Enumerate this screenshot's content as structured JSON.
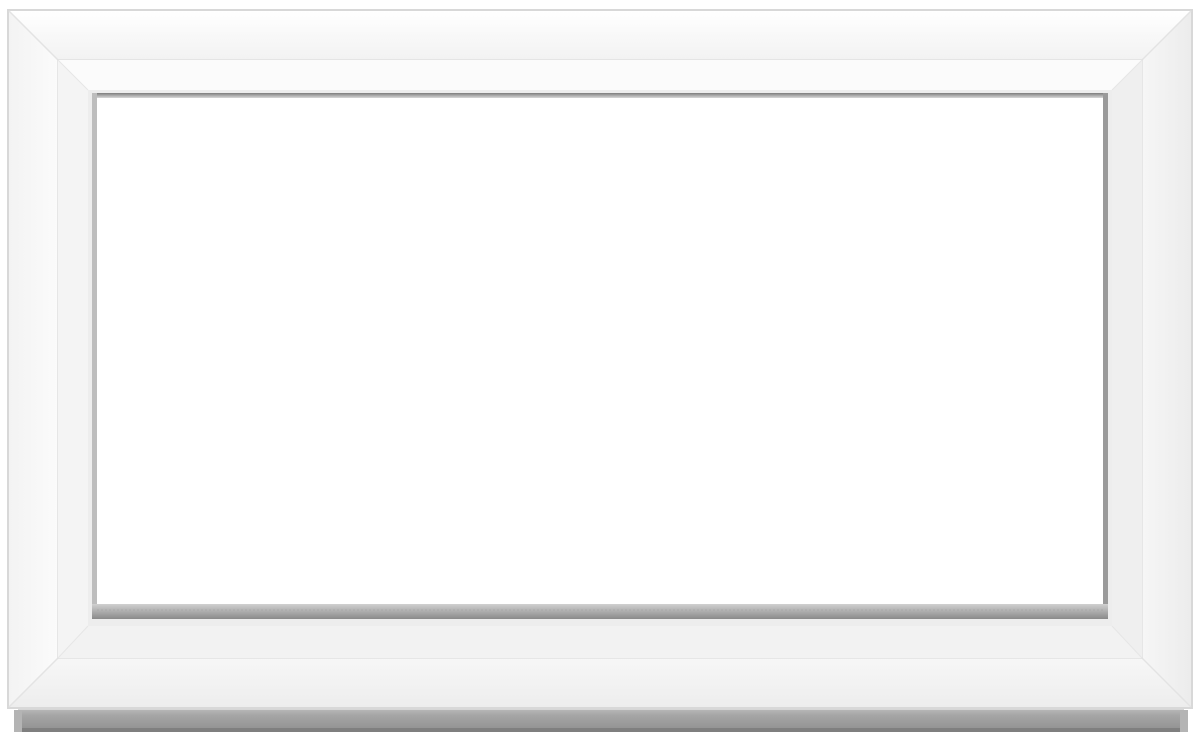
{
  "image": {
    "subject": "window-frame",
    "colors": {
      "background": "#ffffff",
      "frame_outer": "#f4f4f4",
      "frame_inner": "#f7f7f7",
      "frame_edge": "#dcdcdc",
      "glass": "#ffffff",
      "glass_shadow": "#8a8a8a",
      "sill": "#9b9b9b",
      "sill_highlight": "#c9c9c9"
    }
  }
}
